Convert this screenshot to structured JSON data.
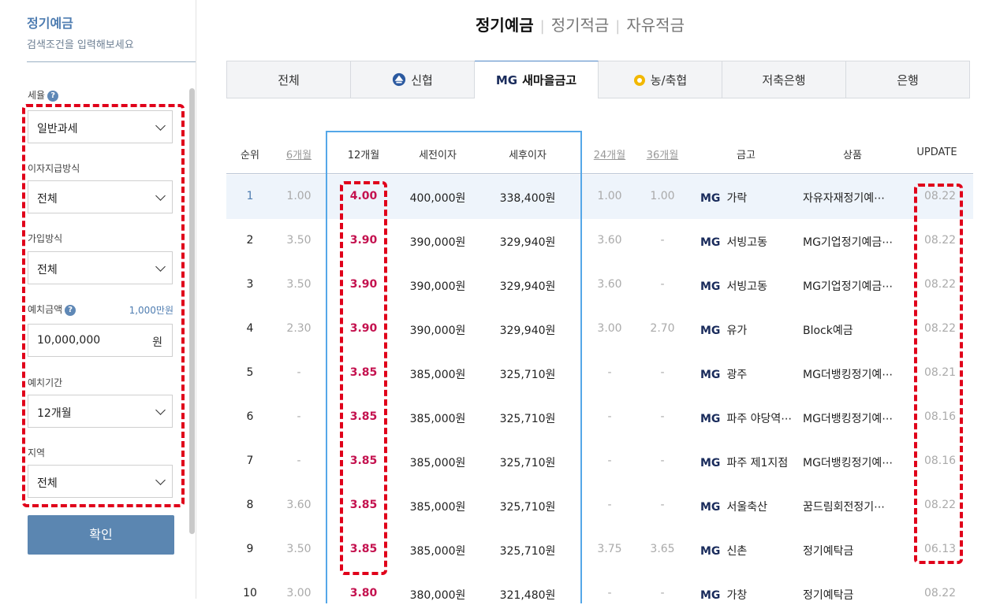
{
  "sidebar": {
    "title": "정기예금",
    "subtitle": "검색조건을 입력해보세요",
    "tax_label": "세율",
    "tax_value": "일반과세",
    "interest_label": "이자지급방식",
    "interest_value": "전체",
    "join_label": "가입방식",
    "join_value": "전체",
    "amount_label": "예치금액",
    "amount_hint": "1,000만원",
    "amount_value": "10,000,000",
    "amount_unit": "원",
    "period_label": "예치기간",
    "period_value": "12개월",
    "region_label": "지역",
    "region_value": "전체",
    "confirm_label": "확인",
    "help_glyph": "?"
  },
  "main_tabs": [
    {
      "label": "정기예금",
      "active": true
    },
    {
      "label": "정기적금",
      "active": false
    },
    {
      "label": "자유적금",
      "active": false
    }
  ],
  "bank_tabs": [
    {
      "label": "전체",
      "icon": "",
      "active": false
    },
    {
      "label": "신협",
      "icon": "shinhyup-logo-icon",
      "active": false
    },
    {
      "label": "새마을금고",
      "icon": "mg-logo",
      "prefix": "MG",
      "active": true
    },
    {
      "label": "농/축협",
      "icon": "nh-logo-icon",
      "active": false
    },
    {
      "label": "저축은행",
      "icon": "",
      "active": false
    },
    {
      "label": "은행",
      "icon": "",
      "active": false
    }
  ],
  "table": {
    "headers": [
      "순위",
      "6개월",
      "12개월",
      "세전이자",
      "세후이자",
      "24개월",
      "36개월",
      "금고",
      "상품",
      "UPDATE"
    ],
    "mg_tag": "MG",
    "rows": [
      {
        "rank": "1",
        "m6": "1.00",
        "m12": "4.00",
        "pre": "400,000원",
        "post": "338,400원",
        "m24": "1.00",
        "m36": "1.00",
        "bank": "가락",
        "product": "자유자재정기예⋯",
        "update": "08.22"
      },
      {
        "rank": "2",
        "m6": "3.50",
        "m12": "3.90",
        "pre": "390,000원",
        "post": "329,940원",
        "m24": "3.60",
        "m36": "-",
        "bank": "서빙고동",
        "product": "MG기업정기예금⋯",
        "update": "08.22"
      },
      {
        "rank": "3",
        "m6": "3.50",
        "m12": "3.90",
        "pre": "390,000원",
        "post": "329,940원",
        "m24": "3.60",
        "m36": "-",
        "bank": "서빙고동",
        "product": "MG기업정기예금⋯",
        "update": "08.22"
      },
      {
        "rank": "4",
        "m6": "2.30",
        "m12": "3.90",
        "pre": "390,000원",
        "post": "329,940원",
        "m24": "3.00",
        "m36": "2.70",
        "bank": "유가",
        "product": "Block예금",
        "update": "08.22"
      },
      {
        "rank": "5",
        "m6": "-",
        "m12": "3.85",
        "pre": "385,000원",
        "post": "325,710원",
        "m24": "-",
        "m36": "-",
        "bank": "광주",
        "product": "MG더뱅킹정기예⋯",
        "update": "08.21"
      },
      {
        "rank": "6",
        "m6": "-",
        "m12": "3.85",
        "pre": "385,000원",
        "post": "325,710원",
        "m24": "-",
        "m36": "-",
        "bank": "파주 야당역⋯",
        "product": "MG더뱅킹정기예⋯",
        "update": "08.16"
      },
      {
        "rank": "7",
        "m6": "-",
        "m12": "3.85",
        "pre": "385,000원",
        "post": "325,710원",
        "m24": "-",
        "m36": "-",
        "bank": "파주 제1지점",
        "product": "MG더뱅킹정기예⋯",
        "update": "08.16"
      },
      {
        "rank": "8",
        "m6": "3.60",
        "m12": "3.85",
        "pre": "385,000원",
        "post": "325,710원",
        "m24": "-",
        "m36": "-",
        "bank": "서울축산",
        "product": "꿈드림회전정기⋯",
        "update": "08.22"
      },
      {
        "rank": "9",
        "m6": "3.50",
        "m12": "3.85",
        "pre": "385,000원",
        "post": "325,710원",
        "m24": "3.75",
        "m36": "3.65",
        "bank": "신촌",
        "product": "정기예탁금",
        "update": "06.13"
      },
      {
        "rank": "10",
        "m6": "3.00",
        "m12": "3.80",
        "pre": "380,000원",
        "post": "321,480원",
        "m24": "-",
        "m36": "-",
        "bank": "가창",
        "product": "정기예탁금",
        "update": "08.22"
      }
    ]
  },
  "colors": {
    "accent": "#4f7db1",
    "rate": "#c4124f",
    "highlight_border": "#55a7e8",
    "annotation": "#e0001a"
  }
}
